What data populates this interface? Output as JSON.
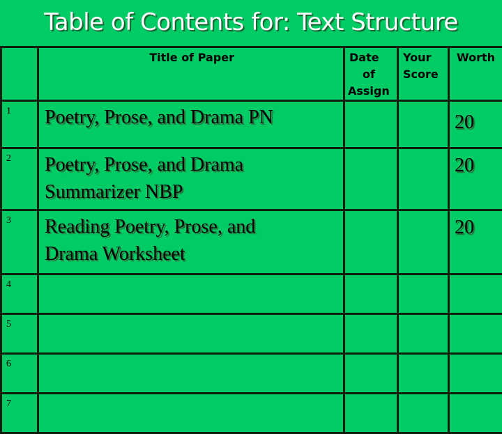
{
  "title": "Table of Contents for: Text Structure",
  "colors": {
    "background": "#00cc66",
    "title_text": "#ffffff",
    "border": "#0d1f0d"
  },
  "headers": {
    "number": "",
    "title": "Title of Paper",
    "date_line1": "Date",
    "date_line2": "of",
    "date_line3": "Assign",
    "score_line1": "Your",
    "score_line2": "Score",
    "worth": "Worth"
  },
  "rows": [
    {
      "number": "1",
      "title": "Poetry, Prose, and Drama PN",
      "date": "",
      "score": "",
      "worth": "20"
    },
    {
      "number": "2",
      "title": "Poetry, Prose, and Drama Summarizer NBP",
      "date": "",
      "score": "",
      "worth": "20"
    },
    {
      "number": "3",
      "title": "Reading Poetry, Prose, and Drama Worksheet",
      "date": "",
      "score": "",
      "worth": "20"
    },
    {
      "number": "4",
      "title": "",
      "date": "",
      "score": "",
      "worth": ""
    },
    {
      "number": "5",
      "title": "",
      "date": "",
      "score": "",
      "worth": ""
    },
    {
      "number": "6",
      "title": "",
      "date": "",
      "score": "",
      "worth": ""
    },
    {
      "number": "7",
      "title": "",
      "date": "",
      "score": "",
      "worth": ""
    }
  ]
}
